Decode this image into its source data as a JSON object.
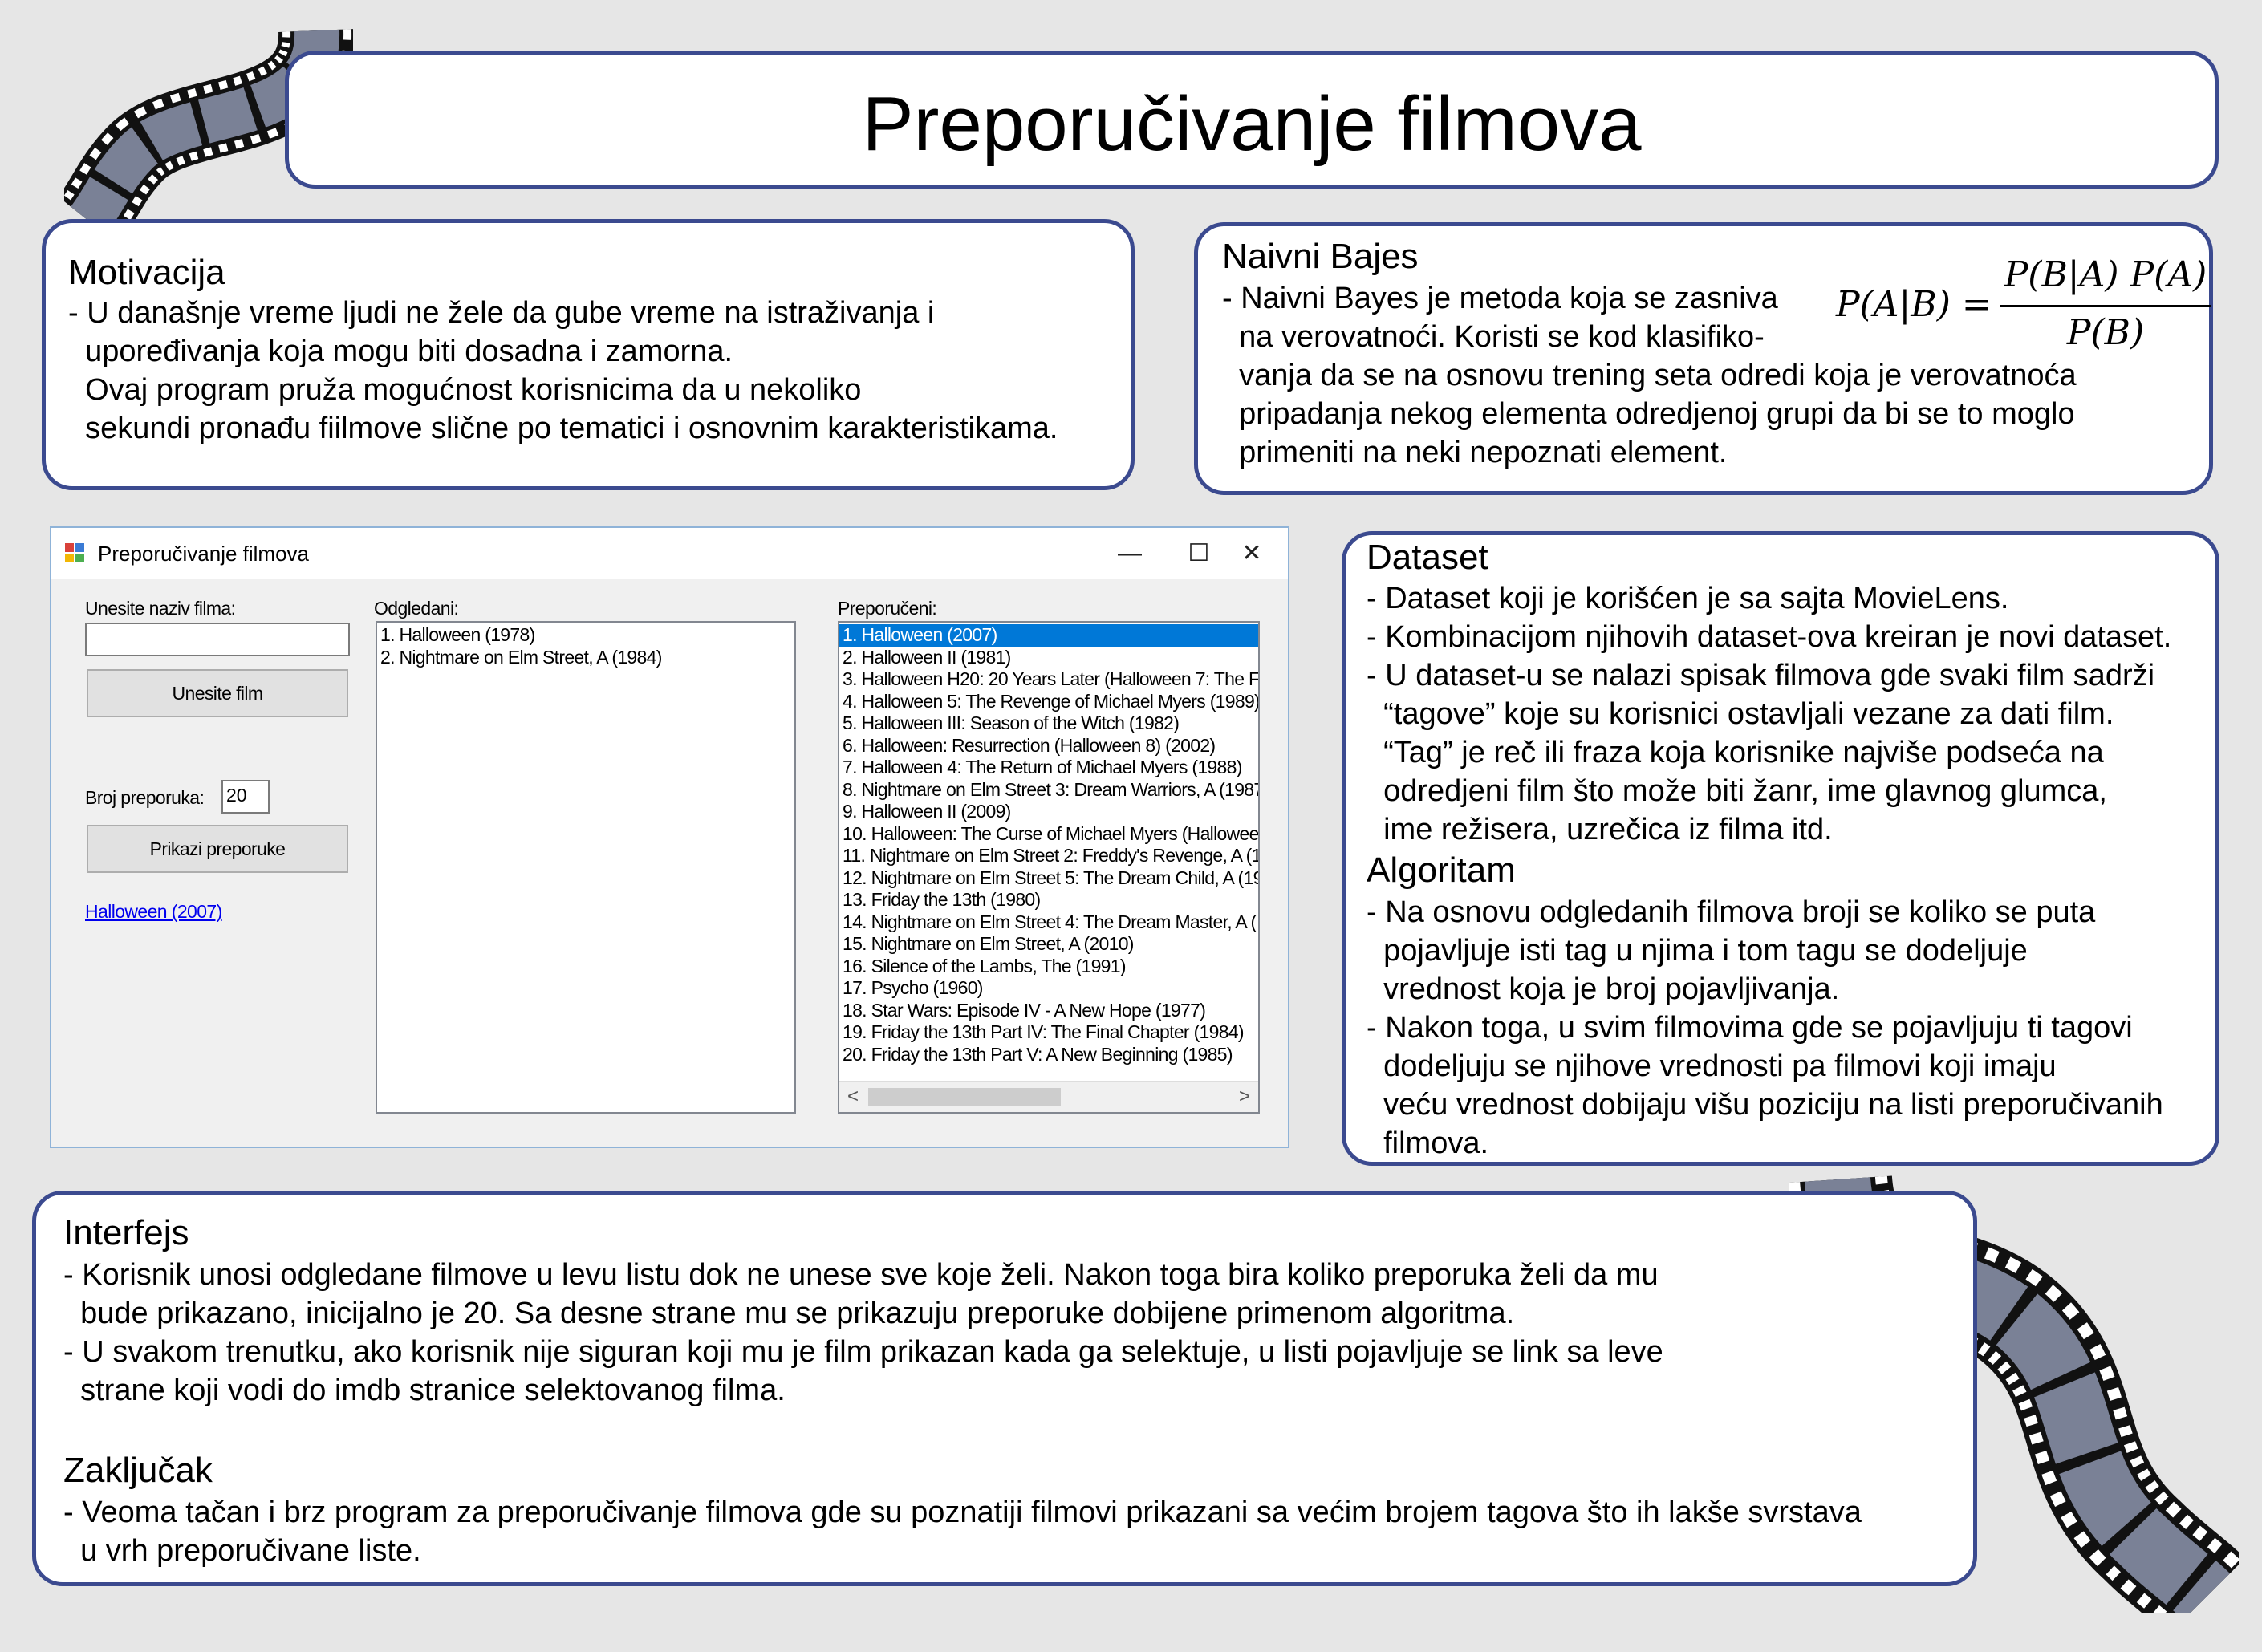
{
  "title": "Preporučivanje filmova",
  "motivacija": {
    "heading": "Motivacija",
    "lines": [
      "- U današnje vreme ljudi ne žele da gube vreme na istraživanja i",
      "  upoređivanja koja mogu biti dosadna i zamorna.",
      "  Ovaj program pruža mogućnost korisnicima da u nekoliko",
      "  sekundi pronađu fiilmove slične po tematici i osnovnim karakteristikama."
    ]
  },
  "naivni_bajes": {
    "heading": "Naivni Bajes",
    "lines": [
      "- Naivni Bayes je metoda koja se zasniva",
      "  na verovatnoći. Koristi se kod klasifiko-",
      "  vanja da se na osnovu trening seta odredi koja je verovatnoća",
      "  pripadanja nekog elementa odredjenoj grupi da bi se to moglo",
      "  primeniti na neki nepoznati element."
    ],
    "formula_lhs": "P(A|B) =",
    "formula_num": "P(B|A) P(A)",
    "formula_den": "P(B)"
  },
  "dataset": {
    "heading": "Dataset",
    "lines": [
      "- Dataset koji je korišćen je sa sajta MovieLens.",
      "- Kombinacijom njihovih dataset-ova kreiran je novi dataset.",
      "- U dataset-u se nalazi spisak filmova gde svaki film sadrži",
      "  “tagove” koje su korisnici ostavljali vezane za dati film.",
      "  “Tag” je reč ili fraza koja korisnike najviše podseća na",
      "  odredjeni film što može biti žanr, ime glavnog glumca,",
      "  ime režisera, uzrečica iz filma itd."
    ]
  },
  "algoritam": {
    "heading": "Algoritam",
    "lines": [
      "- Na osnovu odgledanih filmova broji se koliko se puta",
      "  pojavljuje isti tag u njima i tom tagu se dodeljuje",
      "  vrednost koja je broj pojavljivanja.",
      "- Nakon toga, u svim filmovima gde se pojavljuju ti tagovi",
      "  dodeljuju se njihove vrednosti pa filmovi koji imaju",
      "  veću vrednost dobijaju višu poziciju na listi preporučivanih",
      "  filmova."
    ]
  },
  "interfejs": {
    "heading": "Interfejs",
    "lines": [
      "- Korisnik unosi odgledane filmove u levu listu dok ne unese sve koje želi. Nakon toga bira koliko preporuka želi da mu",
      "  bude prikazano, inicijalno je 20. Sa desne strane mu se prikazuju preporuke dobijene primenom algoritma.",
      "- U svakom trenutku, ako korisnik nije siguran koji mu je film prikazan kada ga selektuje, u listi pojavljuje se link sa leve",
      "  strane koji vodi do imdb stranice selektovanog filma."
    ]
  },
  "zakljucak": {
    "heading": "Zaključak",
    "lines": [
      "- Veoma tačan i brz program za preporučivanje filmova gde su poznatiji filmovi prikazani sa većim brojem tagova što ih lakše svrstava",
      "  u vrh preporučivane liste."
    ]
  },
  "app_window": {
    "title": "Preporučivanje filmova",
    "minimize": "—",
    "maximize": "☐",
    "close": "✕",
    "input_label": "Unesite naziv filma:",
    "input_value": "",
    "enter_button": "Unesite film",
    "count_label": "Broj preporuka:",
    "count_value": "20",
    "show_button": "Prikazi preporuke",
    "link": "Halloween (2007)",
    "watched_label": "Odgledani:",
    "watched": [
      "1. Halloween (1978)",
      "2. Nightmare on Elm Street, A (1984)"
    ],
    "recommended_label": "Preporučeni:",
    "recommended_selected_index": 0,
    "recommended": [
      "1. Halloween (2007)",
      "2. Halloween II (1981)",
      "3. Halloween H20: 20 Years Later (Halloween 7: The F",
      "4. Halloween 5: The Revenge of Michael Myers (1989)",
      "5. Halloween III: Season of the Witch (1982)",
      "6. Halloween: Resurrection (Halloween 8) (2002)",
      "7. Halloween 4: The Return of Michael Myers (1988)",
      "8. Nightmare on Elm Street 3: Dream Warriors, A (1987",
      "9. Halloween II (2009)",
      "10. Halloween: The Curse of Michael Myers (Hallowee",
      "11. Nightmare on Elm Street 2: Freddy's Revenge, A (1",
      "12. Nightmare on Elm Street 5: The Dream Child, A (19",
      "13. Friday the 13th (1980)",
      "14. Nightmare on Elm Street 4: The Dream Master, A (",
      "15. Nightmare on Elm Street, A (2010)",
      "16. Silence of the Lambs, The (1991)",
      "17. Psycho (1960)",
      "18. Star Wars: Episode IV - A New Hope (1977)",
      "19. Friday the 13th Part IV: The Final Chapter (1984)",
      "20. Friday the 13th Part V: A New Beginning (1985)"
    ],
    "scroll_left": "<",
    "scroll_right": ">"
  },
  "colors": {
    "border": "#3b4a8f",
    "selection": "#0078d7",
    "film_frame": "#7a8196"
  }
}
